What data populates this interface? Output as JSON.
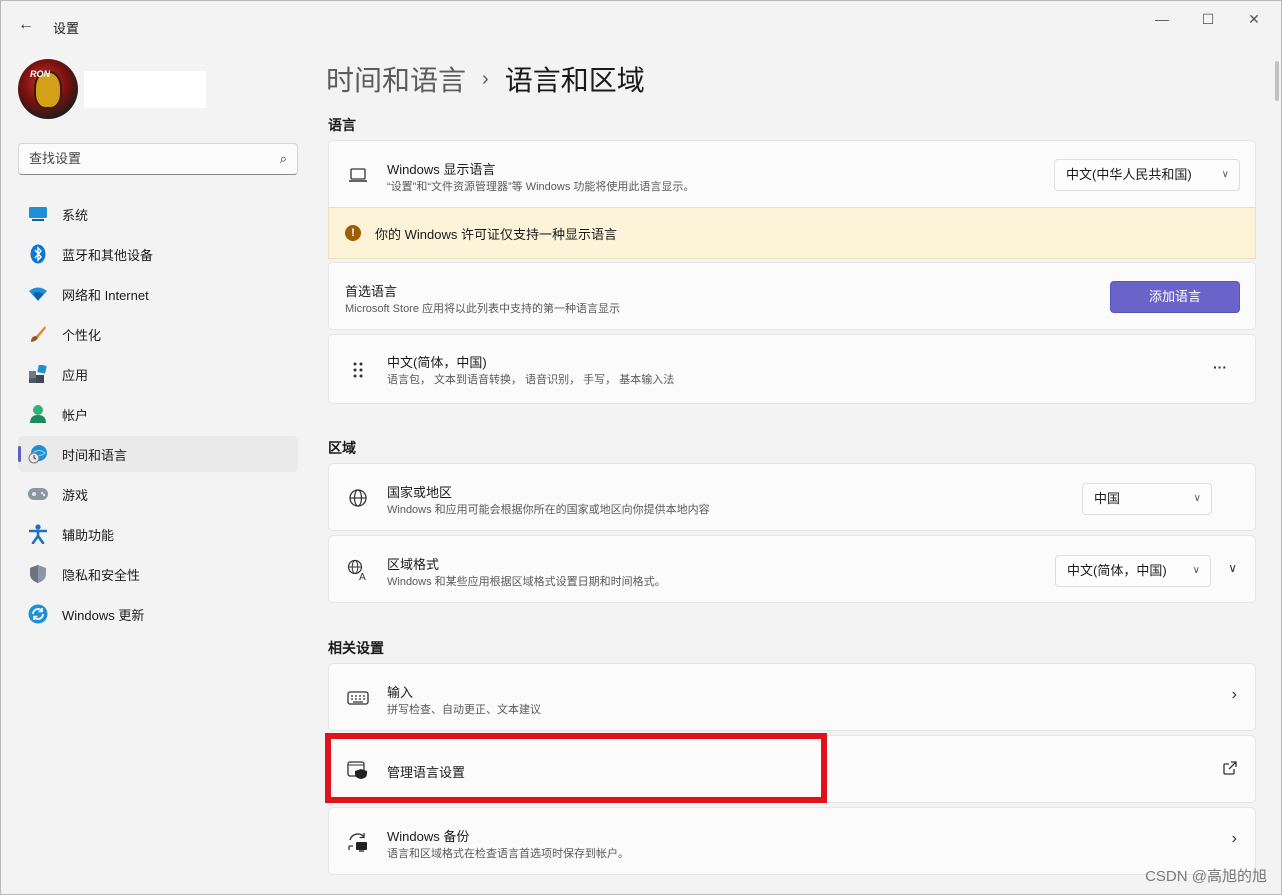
{
  "window": {
    "title": "设置",
    "back_icon": "←",
    "minimize_icon": "—",
    "maximize_icon": "☐",
    "close_icon": "✕"
  },
  "sidebar": {
    "search_placeholder": "查找设置",
    "search_icon": "⌕",
    "items": [
      {
        "label": "系统",
        "icon": "system-icon",
        "active": false
      },
      {
        "label": "蓝牙和其他设备",
        "icon": "bluetooth-icon",
        "active": false
      },
      {
        "label": "网络和 Internet",
        "icon": "wifi-icon",
        "active": false
      },
      {
        "label": "个性化",
        "icon": "brush-icon",
        "active": false
      },
      {
        "label": "应用",
        "icon": "apps-icon",
        "active": false
      },
      {
        "label": "帐户",
        "icon": "account-icon",
        "active": false
      },
      {
        "label": "时间和语言",
        "icon": "time-language-icon",
        "active": true
      },
      {
        "label": "游戏",
        "icon": "gamepad-icon",
        "active": false
      },
      {
        "label": "辅助功能",
        "icon": "accessibility-icon",
        "active": false
      },
      {
        "label": "隐私和安全性",
        "icon": "shield-icon",
        "active": false
      },
      {
        "label": "Windows 更新",
        "icon": "update-icon",
        "active": false
      }
    ]
  },
  "breadcrumb": {
    "parent": "时间和语言",
    "separator": "›",
    "current": "语言和区域"
  },
  "sections": {
    "language": "语言",
    "region": "区域",
    "related": "相关设置"
  },
  "display_language": {
    "title": "Windows 显示语言",
    "subtitle": "“设置”和“文件资源管理器”等 Windows 功能将使用此语言显示。",
    "value": "中文(中华人民共和国)"
  },
  "warning": {
    "icon": "!",
    "text": "你的 Windows 许可证仅支持一种显示语言"
  },
  "preferred_languages": {
    "title": "首选语言",
    "subtitle": "Microsoft Store 应用将以此列表中支持的第一种语言显示",
    "button": "添加语言"
  },
  "language_entry": {
    "title": "中文(简体，中国)",
    "subtitle": "语言包， 文本到语音转换， 语音识别， 手写， 基本输入法",
    "more": "···"
  },
  "country": {
    "title": "国家或地区",
    "subtitle": "Windows 和应用可能会根据你所在的国家或地区向你提供本地内容",
    "value": "中国"
  },
  "regional_format": {
    "title": "区域格式",
    "subtitle": "Windows 和某些应用根据区域格式设置日期和时间格式。",
    "value": "中文(简体，中国)"
  },
  "typing": {
    "title": "输入",
    "subtitle": "拼写检查、自动更正、文本建议"
  },
  "admin_language": {
    "title": "管理语言设置"
  },
  "backup": {
    "title": "Windows 备份",
    "subtitle": "语言和区域格式在检查语言首选项时保存到帐户。"
  },
  "watermark": "CSDN @高旭的旭",
  "colors": {
    "accent": "#6a63c9",
    "highlight": "#e0121b",
    "warning_bg": "#fcf3d8"
  }
}
